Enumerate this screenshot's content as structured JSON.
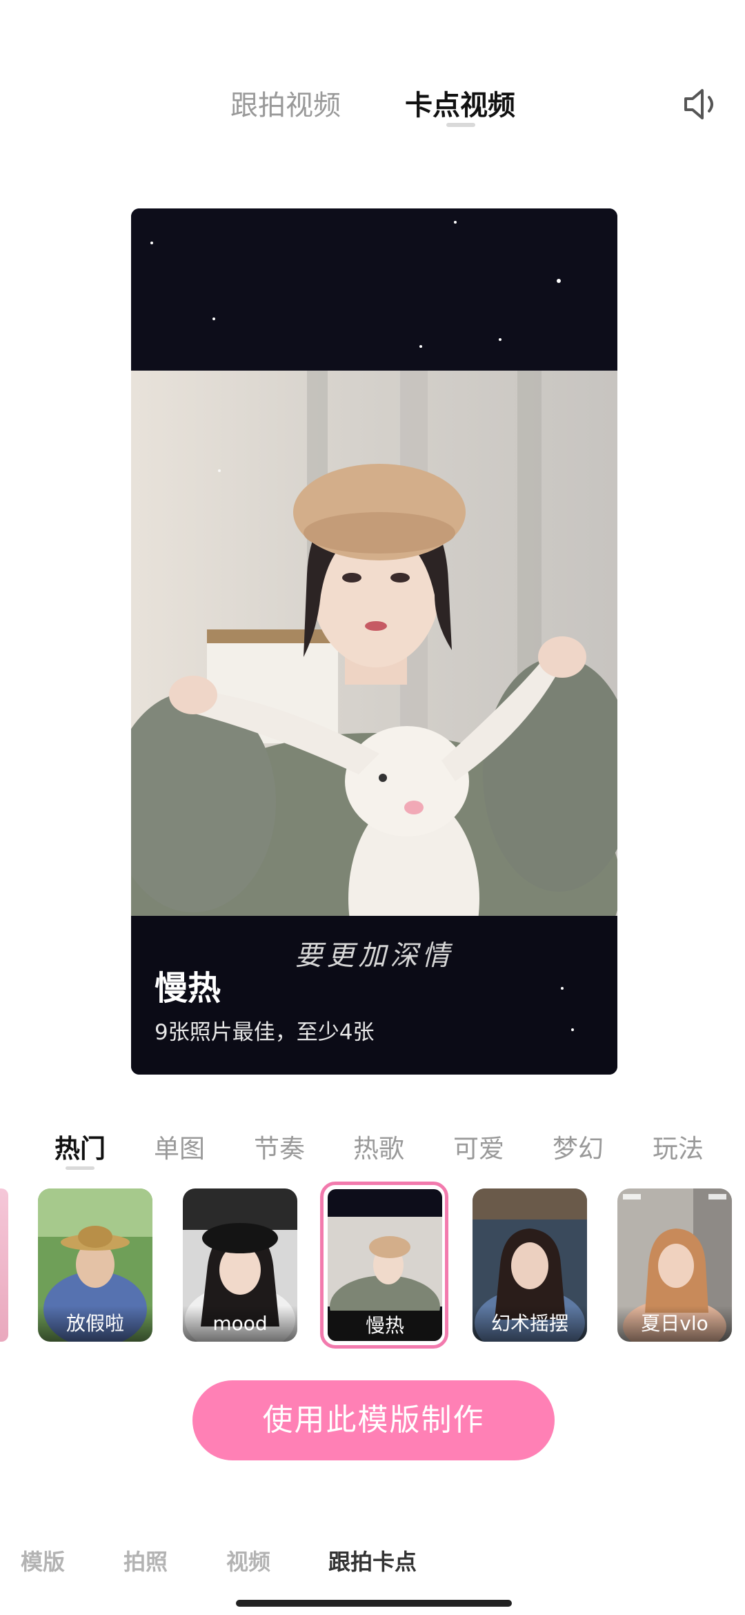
{
  "top_tabs": [
    {
      "label": "跟拍视频",
      "active": false
    },
    {
      "label": "卡点视频",
      "active": true
    }
  ],
  "speaker_icon": "speaker-icon",
  "preview": {
    "title": "慢热",
    "subtitle": "9张照片最佳，至少4张",
    "lyric": "要更加深情"
  },
  "categories": [
    {
      "label": "热门",
      "active": true
    },
    {
      "label": "单图",
      "active": false
    },
    {
      "label": "节奏",
      "active": false
    },
    {
      "label": "热歌",
      "active": false
    },
    {
      "label": "可爱",
      "active": false
    },
    {
      "label": "梦幻",
      "active": false
    },
    {
      "label": "玩法",
      "active": false
    }
  ],
  "templates": [
    {
      "label": "放假啦",
      "selected": false
    },
    {
      "label": "mood",
      "selected": false
    },
    {
      "label": "慢热",
      "selected": true
    },
    {
      "label": "幻术摇摆",
      "selected": false
    },
    {
      "label": "夏日vlo",
      "selected": false
    }
  ],
  "cta_label": "使用此模版制作",
  "bottom_nav": [
    {
      "label": "模版",
      "active": false
    },
    {
      "label": "拍照",
      "active": false
    },
    {
      "label": "视频",
      "active": false
    },
    {
      "label": "跟拍卡点",
      "active": true
    }
  ],
  "colors": {
    "accent": "#ff80b5",
    "selected_border": "#f27aad"
  }
}
